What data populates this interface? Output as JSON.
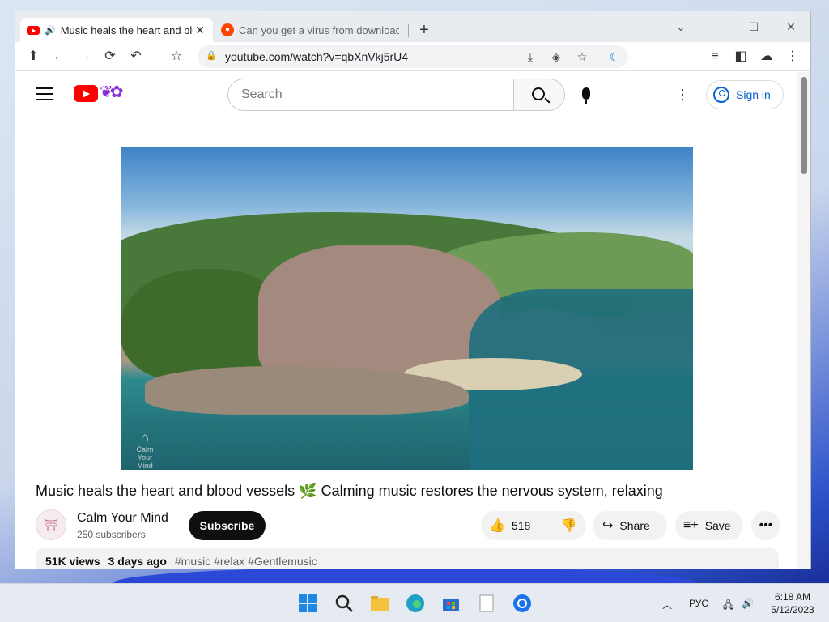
{
  "browser": {
    "tabs": [
      {
        "title": "Music heals the heart and bloo",
        "active": true,
        "favicon": "youtube-favicon"
      },
      {
        "title": "Can you get a virus from downloading",
        "active": false,
        "favicon": "reddit-favicon"
      }
    ],
    "url": "youtube.com/watch?v=qbXnVkj5rU4"
  },
  "youtube": {
    "search_placeholder": "Search",
    "sign_in": "Sign in",
    "video_title": "Music heals the heart and blood vessels 🌿 Calming music restores the nervous system, relaxing",
    "channel_name": "Calm Your Mind",
    "subscribers": "250 subscribers",
    "subscribe_label": "Subscribe",
    "likes": "518",
    "share_label": "Share",
    "save_label": "Save",
    "views": "51K views",
    "posted": "3 days ago",
    "tags": "#music #relax #Gentlemusic",
    "watermark": "Calm Your Mind"
  },
  "taskbar": {
    "lang": "РУС",
    "time": "6:18 AM",
    "date": "5/12/2023"
  },
  "colors": {
    "youtube_red": "#ff0000",
    "link_blue": "#065fd4",
    "reddit_orange": "#ff4500"
  }
}
